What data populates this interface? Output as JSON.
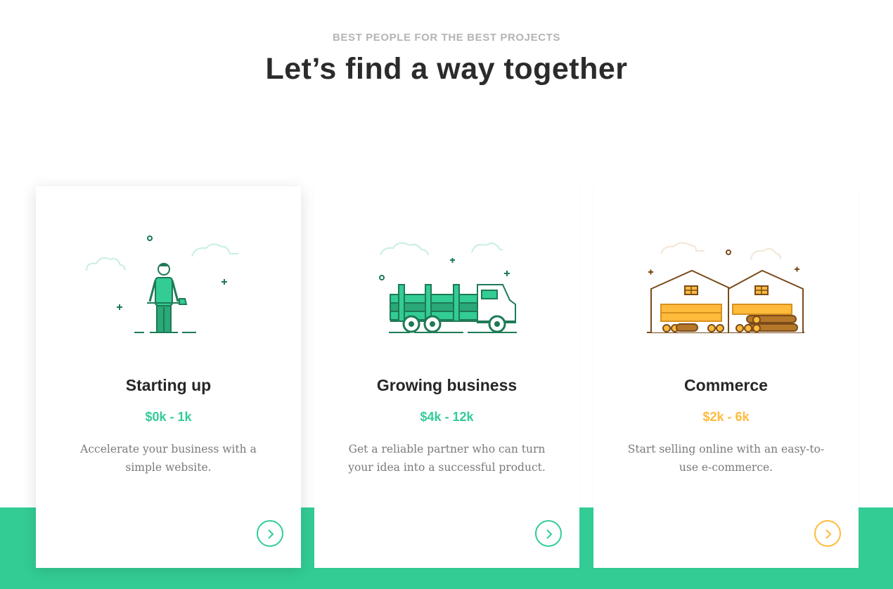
{
  "header": {
    "eyebrow": "BEST PEOPLE FOR THE BEST PROJECTS",
    "title": "Let’s find a way together"
  },
  "colors": {
    "accent_green": "#33cc95",
    "accent_orange": "#ffbb3c",
    "dark_green": "#1e7a55",
    "brown": "#7a4a1a"
  },
  "cards": [
    {
      "title": "Starting up",
      "price": "$0k - 1k",
      "description": "Accelerate your business with a simple website.",
      "icon": "man-with-axe-illustration",
      "accent": "#33cc95"
    },
    {
      "title": "Growing business",
      "price": "$4k - 12k",
      "description": "Get a reliable partner who can turn your idea into a successful product.",
      "icon": "logging-truck-illustration",
      "accent": "#33cc95"
    },
    {
      "title": "Commerce",
      "price": "$2k - 6k",
      "description": "Start selling online with an easy-to-use e-commerce.",
      "icon": "lumber-warehouses-illustration",
      "accent": "#ffbb3c"
    }
  ]
}
